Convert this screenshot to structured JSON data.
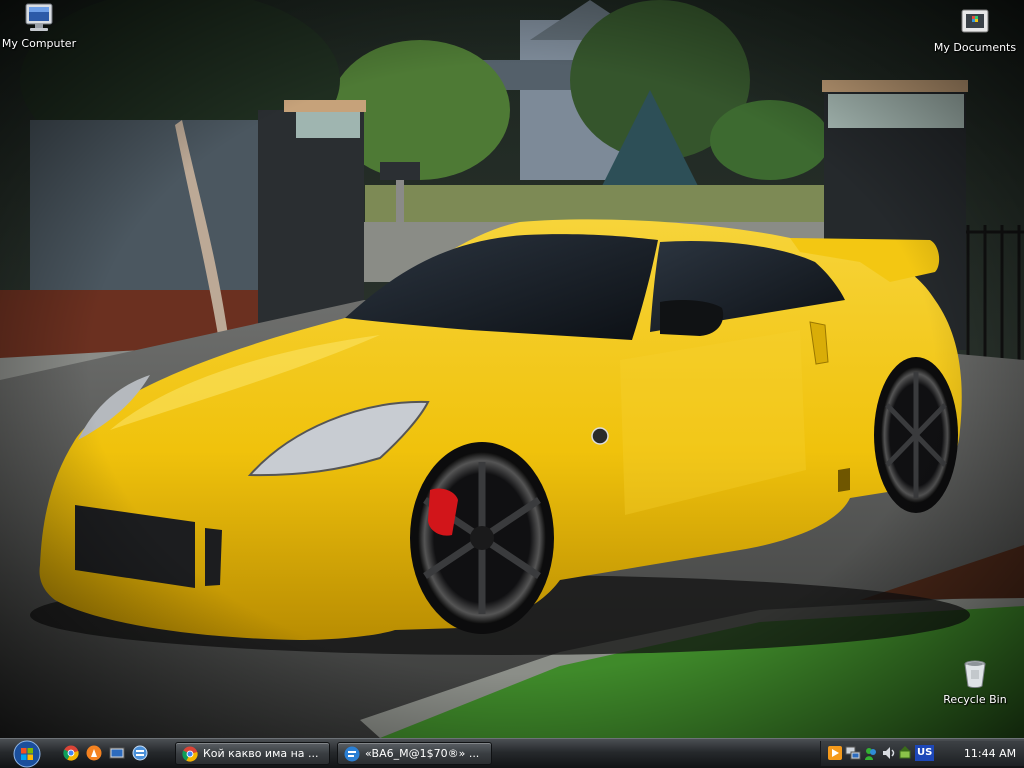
{
  "desktop": {
    "icons": [
      {
        "label": "My Computer",
        "icon": "computer-icon"
      },
      {
        "label": "My Documents",
        "icon": "documents-folder-icon"
      },
      {
        "label": "Recycle Bin",
        "icon": "recycle-bin-icon"
      }
    ],
    "wallpaper": {
      "subject": "yellow-sports-car"
    }
  },
  "taskbar": {
    "start_icon": "windows-orb-icon",
    "quick_launch": [
      {
        "icon": "chrome-icon"
      },
      {
        "icon": "avast-icon"
      },
      {
        "icon": "show-desktop-icon"
      },
      {
        "icon": "switch-windows-icon"
      }
    ],
    "tasks": [
      {
        "label": "Кой какво има на ...",
        "icon": "chrome-icon"
      },
      {
        "label": "«BA6_M@1$70®» ...",
        "icon": "chat-icon"
      }
    ],
    "tray": {
      "icons": [
        "media-player-icon",
        "network-icon",
        "messenger-icon",
        "volume-icon",
        "safely-remove-icon"
      ],
      "language": "US",
      "clock": "11:44 AM"
    }
  },
  "colors": {
    "car_yellow": "#f2c40f",
    "taskbar_dark": "#1d2023",
    "grass_green": "#3f8a2a"
  }
}
